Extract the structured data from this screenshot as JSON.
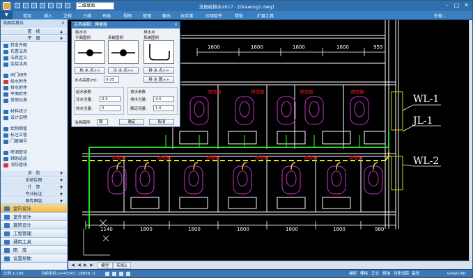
{
  "window": {
    "title": "浩辰给排水2017 - [Drawing1.dwg]",
    "view_select": "二维草图",
    "workspace_label": "外观 -",
    "controls": {
      "minimize": "–",
      "maximize": "□",
      "close": "✕"
    }
  },
  "menu": {
    "items": [
      "常用",
      "插入",
      "注释",
      "三维",
      "布局",
      "视图",
      "管理",
      "输出",
      "云存储",
      "应用软件",
      "帮助",
      "扩展工具"
    ]
  },
  "left_panel": {
    "title": "浩辰给排水",
    "close": "×",
    "categories": [
      {
        "label": "管　线"
      },
      {
        "label": "平　面"
      }
    ],
    "items_a": [
      {
        "label": "转条件图",
        "color": "#2f6fb5"
      },
      {
        "label": "布置洁具",
        "color": "#2f6fb5"
      },
      {
        "label": "洁具定义",
        "color": "#2f6fb5"
      },
      {
        "label": "连接洁具",
        "color": "#2f6fb5"
      }
    ],
    "items_b": [
      {
        "label": "阀门阀件",
        "color": "#2f6fb5"
      },
      {
        "label": "给水附件",
        "color": "#d03a3a"
      },
      {
        "label": "排水附件",
        "color": "#2f6fb5"
      },
      {
        "label": "平面附件",
        "color": "#2f6fb5"
      },
      {
        "label": "常用仪表",
        "color": "#2f6fb5"
      }
    ],
    "items_c": [
      {
        "label": "材料统计",
        "color": "#2f6fb5"
      },
      {
        "label": "设计说明",
        "color": "#2f6fb5"
      }
    ],
    "items_d": [
      {
        "label": "绘制雨管",
        "color": "#2f6fb5"
      },
      {
        "label": "标注立管",
        "color": "#2f6fb5"
      },
      {
        "label": "门窗编号",
        "color": "#2f6fb5"
      }
    ],
    "items_e": [
      {
        "label": "喷洒管径",
        "color": "#2f6fb5"
      },
      {
        "label": "辅助选层",
        "color": "#2f6fb5"
      },
      {
        "label": "消防管线",
        "color": "#d03a3a"
      }
    ],
    "categories_2": [
      {
        "label": "消　防"
      },
      {
        "label": "系统绘图"
      },
      {
        "label": "计　算"
      },
      {
        "label": "专业标注"
      },
      {
        "label": "图库图层"
      }
    ],
    "big_buttons": [
      {
        "label": "室内设计",
        "active": true
      },
      {
        "label": "室外设计",
        "active": false
      },
      {
        "label": "建筑设计",
        "active": false
      },
      {
        "label": "工程管理",
        "active": false
      },
      {
        "label": "通用工具",
        "active": false
      },
      {
        "label": "图　库",
        "active": false
      },
      {
        "label": "设置帮助",
        "active": false
      }
    ]
  },
  "dialog": {
    "title": "洁具编辑：蹲便器",
    "close": "×",
    "group_water_supply": "给水点",
    "group_drain": "排水点",
    "sym_left_label": "平面图例",
    "sym_mid_label": "系统图例",
    "sym_right_label": "系统图例",
    "btn_water_point": "热 水 点>>",
    "btn_cold_point": "冷 水 点>>",
    "btn_drain_point": "排 水 点>>",
    "water_height_label": "水点高度(m):",
    "water_height_value": "0.05",
    "btn_drain_hole": "排 水 圆>>",
    "group_supply_params": "给水参数",
    "group_drain_params": "排水参数",
    "cold_flow_label": "冷水当量:",
    "cold_flow_value": "0.5",
    "hot_flow_label": "热水当量:",
    "hot_flow_value": "0",
    "drain_flow_label": "排水当量:",
    "drain_flow_value": "4.5",
    "design_flow_label": "额定流量:",
    "design_flow_value": "1.5",
    "fixture_name_label": "洁具简称:",
    "fixture_name_value": "蹲",
    "ok": "确定",
    "cancel": "取消"
  },
  "drawing": {
    "top_dims": [
      "1600",
      "1600",
      "1600",
      "1600",
      "959"
    ],
    "bottom_dims": [
      "1140",
      "1800",
      "1800",
      "1800",
      "1800",
      "1800",
      "980"
    ],
    "room_label": "蹲便器",
    "pipe_labels": [
      "WL-1",
      "JL-1",
      "WL-2"
    ],
    "colors": {
      "wall": "#ffffff",
      "fixture": "#cc33cc",
      "water_pipe": "#22e022",
      "drain_pipe": "#e8e022",
      "room_text": "#e01919",
      "pipe_right": "#cccc00"
    }
  },
  "tabs": {
    "items": [
      "模型",
      "布局1"
    ],
    "nav": [
      "◀",
      "◀",
      "▶",
      "▶"
    ]
  },
  "status": {
    "scale": "比例 1:100",
    "coords": "当前坐标:x=43347, 18858, 0",
    "right_items": [
      "捕捉",
      "栅格",
      "正交",
      "极轴",
      "对象追踪",
      "基线"
    ],
    "brand": "GstarCAD"
  }
}
